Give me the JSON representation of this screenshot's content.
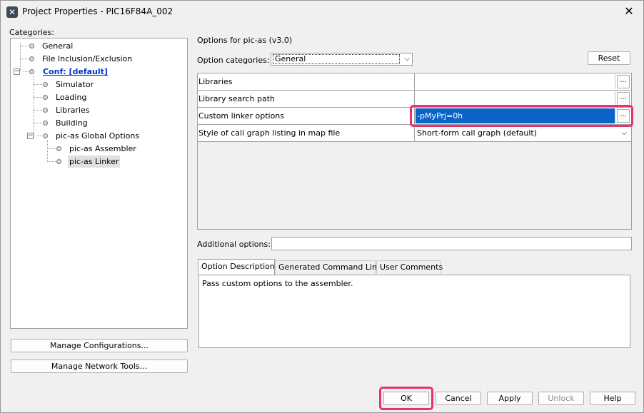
{
  "window": {
    "title": "Project Properties - PIC16F84A_002",
    "icon": "mplab-x-icon",
    "close_glyph": "✕"
  },
  "categories": {
    "label": "Categories:",
    "items": [
      {
        "label": "General",
        "level": 1
      },
      {
        "label": "File Inclusion/Exclusion",
        "level": 1
      },
      {
        "label": "Conf: [default]",
        "level": 1,
        "expanded": true,
        "conf": true
      },
      {
        "label": "Simulator",
        "level": 2
      },
      {
        "label": "Loading",
        "level": 2
      },
      {
        "label": "Libraries",
        "level": 2
      },
      {
        "label": "Building",
        "level": 2
      },
      {
        "label": "pic-as Global Options",
        "level": 2,
        "expanded": true
      },
      {
        "label": "pic-as Assembler",
        "level": 3
      },
      {
        "label": "pic-as Linker",
        "level": 3,
        "selected": true
      }
    ],
    "expander_glyph": "−"
  },
  "left_buttons": {
    "manage_configurations": "Manage Configurations...",
    "manage_network_tools": "Manage Network Tools..."
  },
  "options": {
    "title": "Options for pic-as (v3.0)",
    "category_label": "Option categories:",
    "category_value": "General",
    "dropdown_glyph": "⌵",
    "reset_label": "Reset",
    "rows": [
      {
        "name": "Libraries",
        "value": "",
        "kind": "text"
      },
      {
        "name": "Library search path",
        "value": "",
        "kind": "text"
      },
      {
        "name": "Custom linker options",
        "value": "-pMyPrj=0h",
        "kind": "text",
        "selected": true
      },
      {
        "name": "Style of call graph listing in map file",
        "value": "Short-form call graph (default)",
        "kind": "dropdown"
      }
    ],
    "ellipsis_label": "...",
    "additional_label": "Additional options:",
    "additional_value": ""
  },
  "tabs": [
    {
      "label": "Option Description",
      "active": true
    },
    {
      "label": "Generated Command Line",
      "active": false
    },
    {
      "label": "User Comments",
      "active": false
    }
  ],
  "description": "Pass custom options to the assembler.",
  "footer": {
    "ok": "OK",
    "cancel": "Cancel",
    "apply": "Apply",
    "unlock": "Unlock",
    "help": "Help"
  },
  "colors": {
    "highlight": "#e8336e",
    "selection": "#0a64c8",
    "conf_link": "#0033cc"
  }
}
